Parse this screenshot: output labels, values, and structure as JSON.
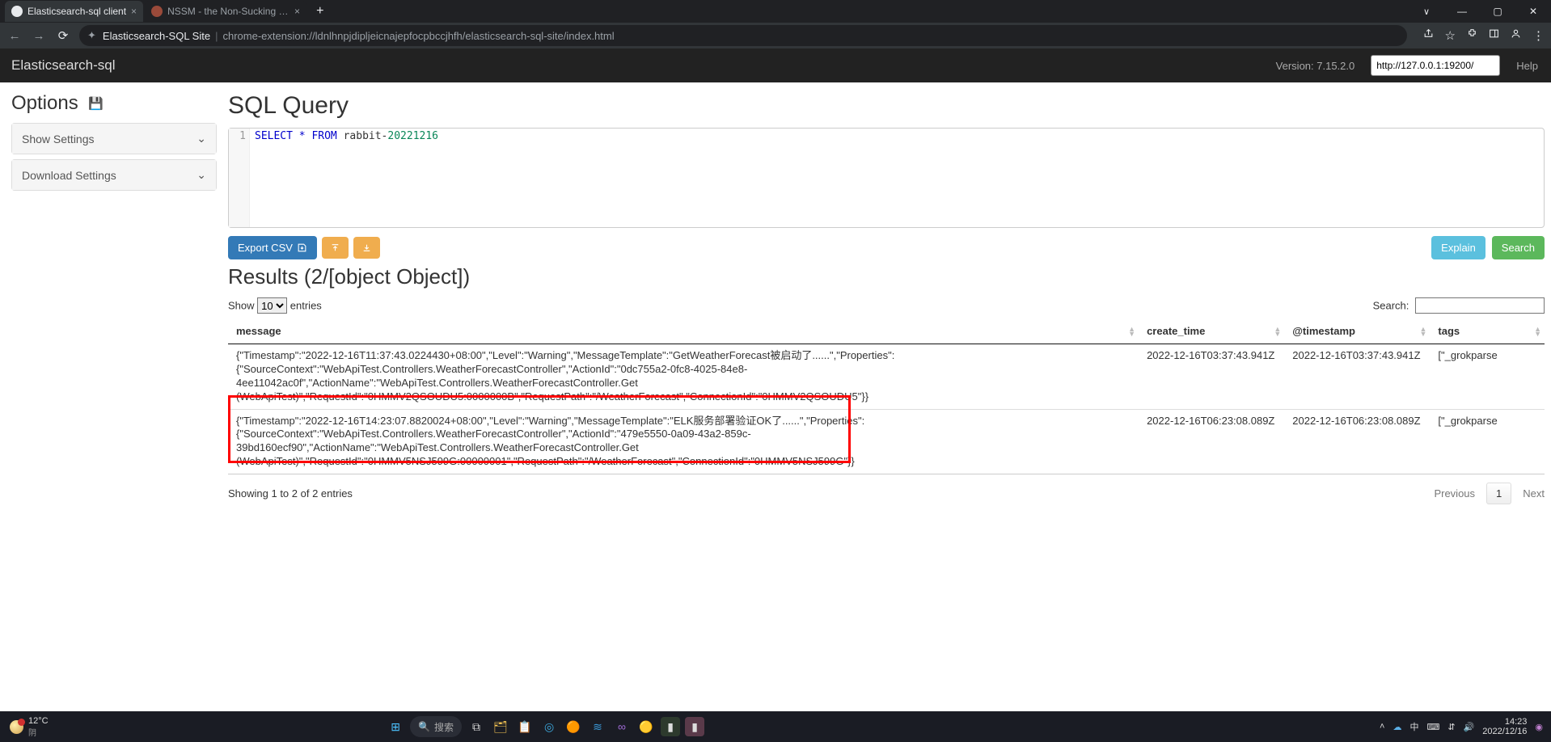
{
  "browser": {
    "tabs": [
      {
        "title": "Elasticsearch-sql client",
        "active": true
      },
      {
        "title": "NSSM - the Non-Sucking Serv",
        "active": false
      }
    ],
    "url_site": "Elasticsearch-SQL Site",
    "url_rest": "chrome-extension://ldnlhnpjdipljeicnajepfocpbccjhfh/elasticsearch-sql-site/index.html"
  },
  "app": {
    "title": "Elasticsearch-sql",
    "version": "Version: 7.15.2.0",
    "url_value": "http://127.0.0.1:19200/",
    "help": "Help"
  },
  "sidebar": {
    "options": "Options",
    "panels": [
      "Show Settings",
      "Download Settings"
    ]
  },
  "main": {
    "heading": "SQL Query",
    "sql": {
      "select": "SELECT",
      "star": "*",
      "from": "FROM",
      "ident": "rabbit-",
      "date": "20221216"
    },
    "export_csv": "Export CSV",
    "explain": "Explain",
    "search": "Search",
    "results_heading": "Results (2/[object Object])"
  },
  "dt": {
    "show": "Show",
    "entries": "entries",
    "length_options": [
      "10"
    ],
    "search_label": "Search:",
    "columns": [
      "message",
      "create_time",
      "@timestamp",
      "tags"
    ],
    "rows": [
      {
        "message": "{\"Timestamp\":\"2022-12-16T11:37:43.0224430+08:00\",\"Level\":\"Warning\",\"MessageTemplate\":\"GetWeatherForecast被启动了......\",\"Properties\":{\"SourceContext\":\"WebApiTest.Controllers.WeatherForecastController\",\"ActionId\":\"0dc755a2-0fc8-4025-84e8-4ee11042ac0f\",\"ActionName\":\"WebApiTest.Controllers.WeatherForecastController.Get (WebApiTest)\",\"RequestId\":\"0HMMV2QSOUDU5:0000000B\",\"RequestPath\":\"/WeatherForecast\",\"ConnectionId\":\"0HMMV2QSOUDU5\"}}",
        "create_time": "2022-12-16T03:37:43.941Z",
        "timestamp": "2022-12-16T03:37:43.941Z",
        "tags": "[\"_grokparse"
      },
      {
        "message": "{\"Timestamp\":\"2022-12-16T14:23:07.8820024+08:00\",\"Level\":\"Warning\",\"MessageTemplate\":\"ELK服务部署验证OK了......\",\"Properties\":{\"SourceContext\":\"WebApiTest.Controllers.WeatherForecastController\",\"ActionId\":\"479e5550-0a09-43a2-859c-39bd160ecf90\",\"ActionName\":\"WebApiTest.Controllers.WeatherForecastController.Get (WebApiTest)\",\"RequestId\":\"0HMMV5NSJ599G:00000001\",\"RequestPath\":\"/WeatherForecast\",\"ConnectionId\":\"0HMMV5NSJ599G\"}}",
        "create_time": "2022-12-16T06:23:08.089Z",
        "timestamp": "2022-12-16T06:23:08.089Z",
        "tags": "[\"_grokparse"
      }
    ],
    "info": "Showing 1 to 2 of 2 entries",
    "previous": "Previous",
    "page": "1",
    "next": "Next"
  },
  "taskbar": {
    "temp": "12°C",
    "cond": "阴",
    "search": "搜索",
    "ime": "中",
    "time": "14:23",
    "date": "2022/12/16"
  }
}
